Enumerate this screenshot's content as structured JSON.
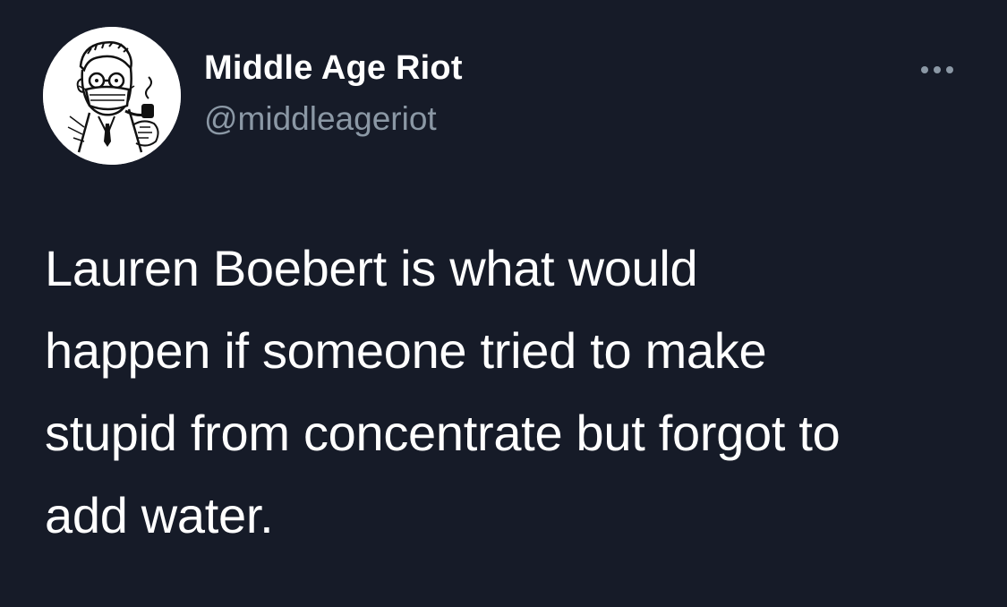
{
  "author": {
    "display_name": "Middle Age Riot",
    "handle": "@middleageriot",
    "avatar_icon": "man-with-mask-and-pipe-illustration"
  },
  "menu": {
    "icon": "more-horizontal-icon"
  },
  "tweet": {
    "lines": [
      "Lauren Boebert is what would",
      "happen if someone tried to make",
      "stupid from concentrate but forgot to",
      "add water."
    ]
  },
  "colors": {
    "background": "#161b28",
    "text_primary": "#ffffff",
    "text_secondary": "#8b98a5"
  }
}
